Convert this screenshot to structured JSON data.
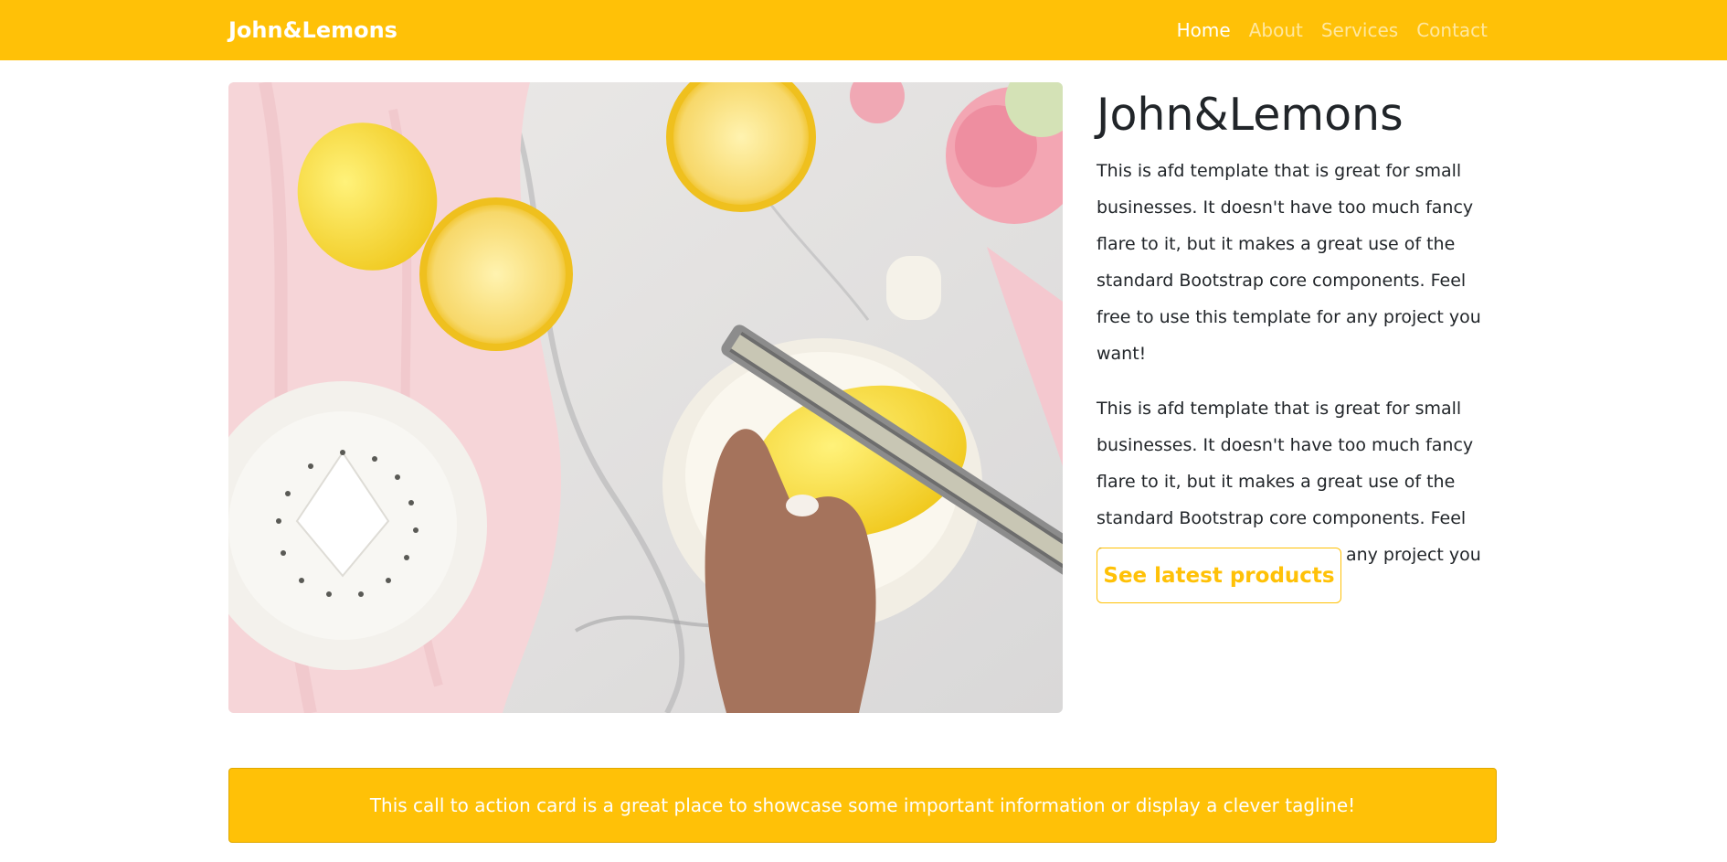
{
  "navbar": {
    "brand": "John&Lemons",
    "links": [
      {
        "label": "Home",
        "active": true
      },
      {
        "label": "About",
        "active": false
      },
      {
        "label": "Services",
        "active": false
      },
      {
        "label": "Contact",
        "active": false
      }
    ]
  },
  "hero": {
    "image_description_icon": "lemon-zester-photo",
    "title": "John&Lemons",
    "paragraphs": [
      "This is afd template that is great for small businesses. It doesn't have too much fancy flare to it, but it makes a great use of the standard Bootstrap core components. Feel free to use this template for any project you want!",
      "This is afd template that is great for small businesses. It doesn't have too much fancy flare to it, but it makes a great use of the standard Bootstrap core components. Feel free to use this template for any project you want!"
    ],
    "button_label": "See latest products"
  },
  "cta_card": {
    "text": "This call to action card is a great place to showcase some important information or display a clever tagline!"
  },
  "colors": {
    "brand_yellow": "#ffc107",
    "text_dark": "#212529",
    "white": "#ffffff"
  }
}
